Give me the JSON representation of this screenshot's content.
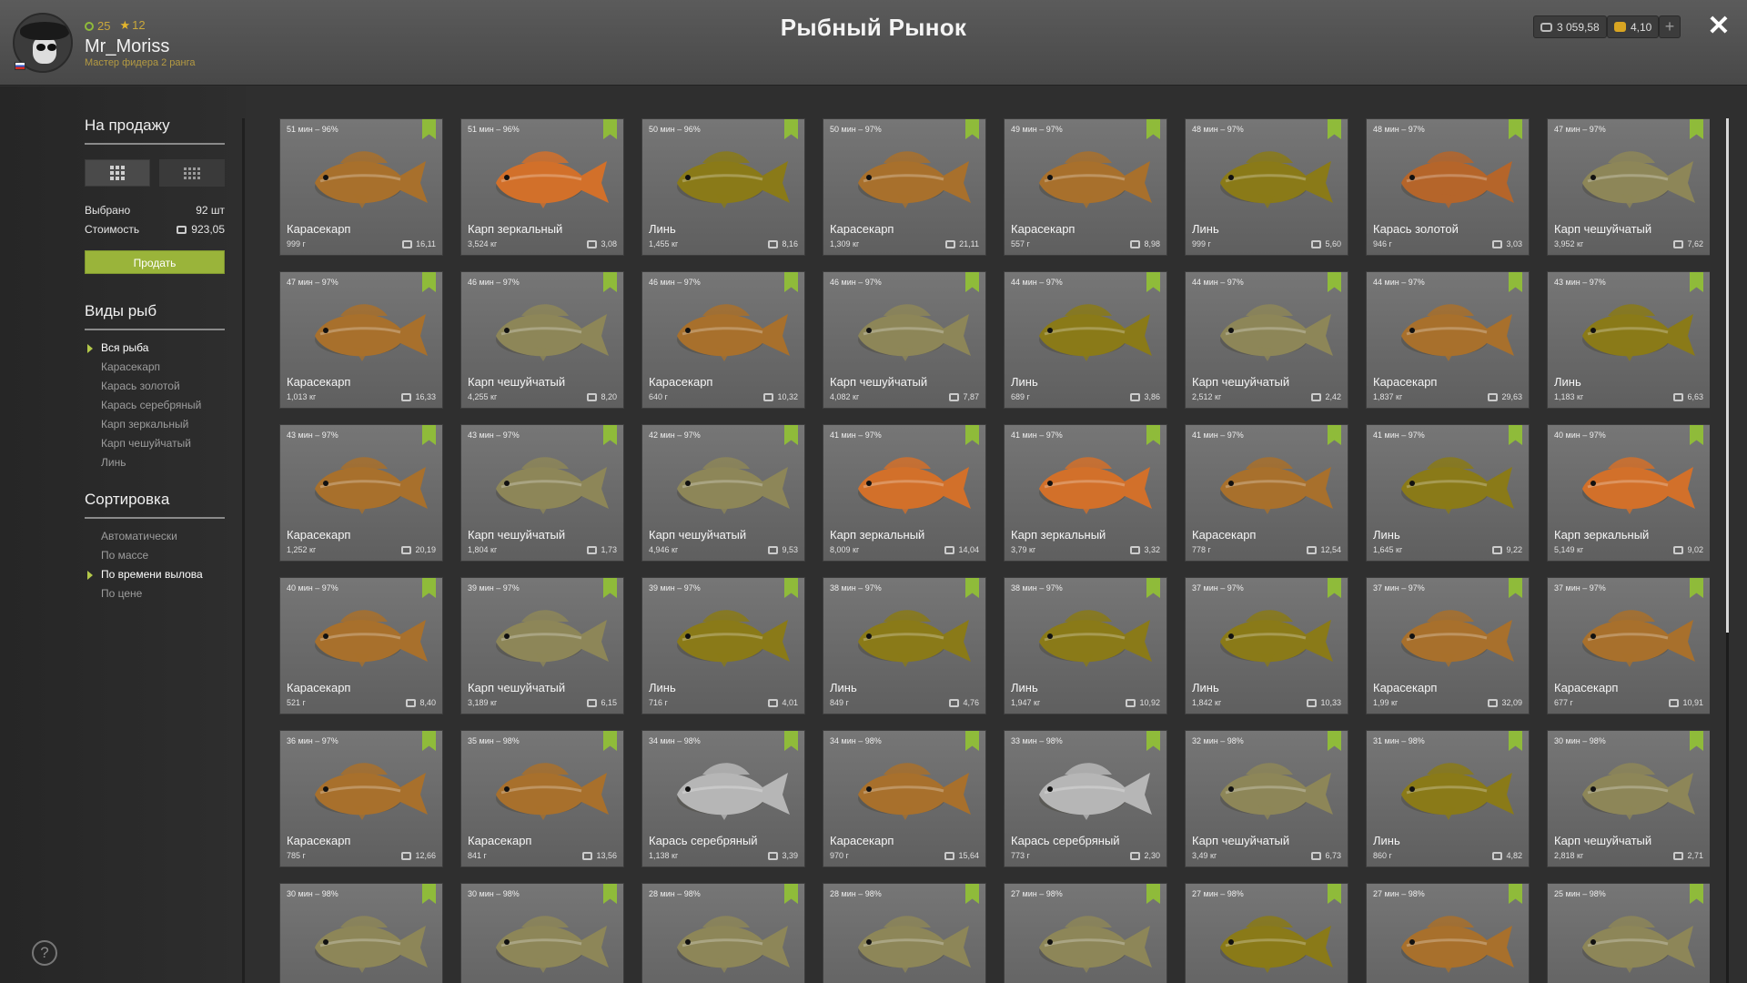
{
  "window": {
    "title": "Рыбный Рынок",
    "close_label": "✕",
    "plus_label": "+"
  },
  "player": {
    "level": "25",
    "stars": "12",
    "name": "Mr_Moriss",
    "rank": "Мастер фидера 2 ранга"
  },
  "currency": {
    "silver": "3 059,58",
    "gold": "4,10"
  },
  "left": {
    "for_sale_title": "На продажу",
    "selected_label": "Выбрано",
    "selected_value": "92 шт",
    "cost_label": "Стоимость",
    "cost_value": "923,05",
    "sell_label": "Продать",
    "species_title": "Виды рыб",
    "species": [
      "Вся рыба",
      "Карасекарп",
      "Карась золотой",
      "Карась серебряный",
      "Карп зеркальный",
      "Карп чешуйчатый",
      "Линь"
    ],
    "species_active": 0,
    "sort_title": "Сортировка",
    "sort": [
      "Автоматически",
      "По массе",
      "По времени вылова",
      "По цене"
    ],
    "sort_active": 2,
    "help_label": "?"
  },
  "cards": [
    {
      "time": "51 мин – 96%",
      "name": "Карасекарп",
      "weight": "999 г",
      "price": "16,11"
    },
    {
      "time": "51 мин – 96%",
      "name": "Карп зеркальный",
      "weight": "3,524 кг",
      "price": "3,08"
    },
    {
      "time": "50 мин – 96%",
      "name": "Линь",
      "weight": "1,455 кг",
      "price": "8,16"
    },
    {
      "time": "50 мин – 97%",
      "name": "Карасекарп",
      "weight": "1,309 кг",
      "price": "21,11"
    },
    {
      "time": "49 мин – 97%",
      "name": "Карасекарп",
      "weight": "557 г",
      "price": "8,98"
    },
    {
      "time": "48 мин – 97%",
      "name": "Линь",
      "weight": "999 г",
      "price": "5,60"
    },
    {
      "time": "48 мин – 97%",
      "name": "Карась золотой",
      "weight": "946 г",
      "price": "3,03"
    },
    {
      "time": "47 мин – 97%",
      "name": "Карп чешуйчатый",
      "weight": "3,952 кг",
      "price": "7,62"
    },
    {
      "time": "47 мин – 97%",
      "name": "Карасекарп",
      "weight": "1,013 кг",
      "price": "16,33"
    },
    {
      "time": "46 мин – 97%",
      "name": "Карп чешуйчатый",
      "weight": "4,255 кг",
      "price": "8,20"
    },
    {
      "time": "46 мин – 97%",
      "name": "Карасекарп",
      "weight": "640 г",
      "price": "10,32"
    },
    {
      "time": "46 мин – 97%",
      "name": "Карп чешуйчатый",
      "weight": "4,082 кг",
      "price": "7,87"
    },
    {
      "time": "44 мин – 97%",
      "name": "Линь",
      "weight": "689 г",
      "price": "3,86"
    },
    {
      "time": "44 мин – 97%",
      "name": "Карп чешуйчатый",
      "weight": "2,512 кг",
      "price": "2,42"
    },
    {
      "time": "44 мин – 97%",
      "name": "Карасекарп",
      "weight": "1,837 кг",
      "price": "29,63"
    },
    {
      "time": "43 мин – 97%",
      "name": "Линь",
      "weight": "1,183 кг",
      "price": "6,63"
    },
    {
      "time": "43 мин – 97%",
      "name": "Карасекарп",
      "weight": "1,252 кг",
      "price": "20,19"
    },
    {
      "time": "43 мин – 97%",
      "name": "Карп чешуйчатый",
      "weight": "1,804 кг",
      "price": "1,73"
    },
    {
      "time": "42 мин – 97%",
      "name": "Карп чешуйчатый",
      "weight": "4,946 кг",
      "price": "9,53"
    },
    {
      "time": "41 мин – 97%",
      "name": "Карп зеркальный",
      "weight": "8,009 кг",
      "price": "14,04"
    },
    {
      "time": "41 мин – 97%",
      "name": "Карп зеркальный",
      "weight": "3,79 кг",
      "price": "3,32"
    },
    {
      "time": "41 мин – 97%",
      "name": "Карасекарп",
      "weight": "778 г",
      "price": "12,54"
    },
    {
      "time": "41 мин – 97%",
      "name": "Линь",
      "weight": "1,645 кг",
      "price": "9,22"
    },
    {
      "time": "40 мин – 97%",
      "name": "Карп зеркальный",
      "weight": "5,149 кг",
      "price": "9,02"
    },
    {
      "time": "40 мин – 97%",
      "name": "Карасекарп",
      "weight": "521 г",
      "price": "8,40"
    },
    {
      "time": "39 мин – 97%",
      "name": "Карп чешуйчатый",
      "weight": "3,189 кг",
      "price": "6,15"
    },
    {
      "time": "39 мин – 97%",
      "name": "Линь",
      "weight": "716 г",
      "price": "4,01"
    },
    {
      "time": "38 мин – 97%",
      "name": "Линь",
      "weight": "849 г",
      "price": "4,76"
    },
    {
      "time": "38 мин – 97%",
      "name": "Линь",
      "weight": "1,947 кг",
      "price": "10,92"
    },
    {
      "time": "37 мин – 97%",
      "name": "Линь",
      "weight": "1,842 кг",
      "price": "10,33"
    },
    {
      "time": "37 мин – 97%",
      "name": "Карасекарп",
      "weight": "1,99 кг",
      "price": "32,09"
    },
    {
      "time": "37 мин – 97%",
      "name": "Карасекарп",
      "weight": "677 г",
      "price": "10,91"
    },
    {
      "time": "36 мин – 97%",
      "name": "Карасекарп",
      "weight": "785 г",
      "price": "12,66"
    },
    {
      "time": "35 мин – 98%",
      "name": "Карасекарп",
      "weight": "841 г",
      "price": "13,56"
    },
    {
      "time": "34 мин – 98%",
      "name": "Карась серебряный",
      "weight": "1,138 кг",
      "price": "3,39"
    },
    {
      "time": "34 мин – 98%",
      "name": "Карасекарп",
      "weight": "970 г",
      "price": "15,64"
    },
    {
      "time": "33 мин – 98%",
      "name": "Карась серебряный",
      "weight": "773 г",
      "price": "2,30"
    },
    {
      "time": "32 мин – 98%",
      "name": "Карп чешуйчатый",
      "weight": "3,49 кг",
      "price": "6,73"
    },
    {
      "time": "31 мин – 98%",
      "name": "Линь",
      "weight": "860 г",
      "price": "4,82"
    },
    {
      "time": "30 мин – 98%",
      "name": "Карп чешуйчатый",
      "weight": "2,818 кг",
      "price": "2,71"
    },
    {
      "time": "30 мин – 98%",
      "name": "",
      "weight": "",
      "price": ""
    },
    {
      "time": "30 мин – 98%",
      "name": "",
      "weight": "",
      "price": ""
    },
    {
      "time": "28 мин – 98%",
      "name": "",
      "weight": "",
      "price": ""
    },
    {
      "time": "28 мин – 98%",
      "name": "",
      "weight": "",
      "price": ""
    },
    {
      "time": "27 мин – 98%",
      "name": "",
      "weight": "",
      "price": ""
    },
    {
      "time": "27 мин – 98%",
      "name": "",
      "weight": "",
      "price": ""
    },
    {
      "time": "27 мин – 98%",
      "name": "",
      "weight": "",
      "price": ""
    },
    {
      "time": "25 мин – 98%",
      "name": "",
      "weight": "",
      "price": ""
    }
  ],
  "fish_icons": [
    "crucian-carp-icon",
    "mirror-carp-icon",
    "tench-icon",
    "crucian-carp-icon",
    "crucian-carp-icon",
    "tench-icon",
    "golden-crucian-icon",
    "common-carp-icon",
    "crucian-carp-icon",
    "common-carp-icon",
    "crucian-carp-icon",
    "common-carp-icon",
    "tench-icon",
    "common-carp-icon",
    "crucian-carp-icon",
    "tench-icon",
    "crucian-carp-icon",
    "common-carp-icon",
    "common-carp-icon",
    "mirror-carp-icon",
    "mirror-carp-icon",
    "crucian-carp-icon",
    "tench-icon",
    "mirror-carp-icon",
    "crucian-carp-icon",
    "common-carp-icon",
    "tench-icon",
    "tench-icon",
    "tench-icon",
    "tench-icon",
    "crucian-carp-icon",
    "crucian-carp-icon",
    "crucian-carp-icon",
    "crucian-carp-icon",
    "silver-crucian-icon",
    "crucian-carp-icon",
    "silver-crucian-icon",
    "common-carp-icon",
    "tench-icon",
    "common-carp-icon",
    "common-carp-icon",
    "common-carp-icon",
    "common-carp-icon",
    "common-carp-icon",
    "common-carp-icon",
    "tench-icon",
    "crucian-carp-icon",
    "common-carp-icon"
  ],
  "fish_colors": {
    "crucian-carp-icon": "#a8702c",
    "mirror-carp-icon": "#d2702a",
    "tench-icon": "#8a7a18",
    "golden-crucian-icon": "#b5652a",
    "common-carp-icon": "#8d8658",
    "silver-crucian-icon": "#b6b6b6"
  },
  "colors": {
    "accent": "#8fbb3a",
    "sell": "#9ab43a"
  }
}
